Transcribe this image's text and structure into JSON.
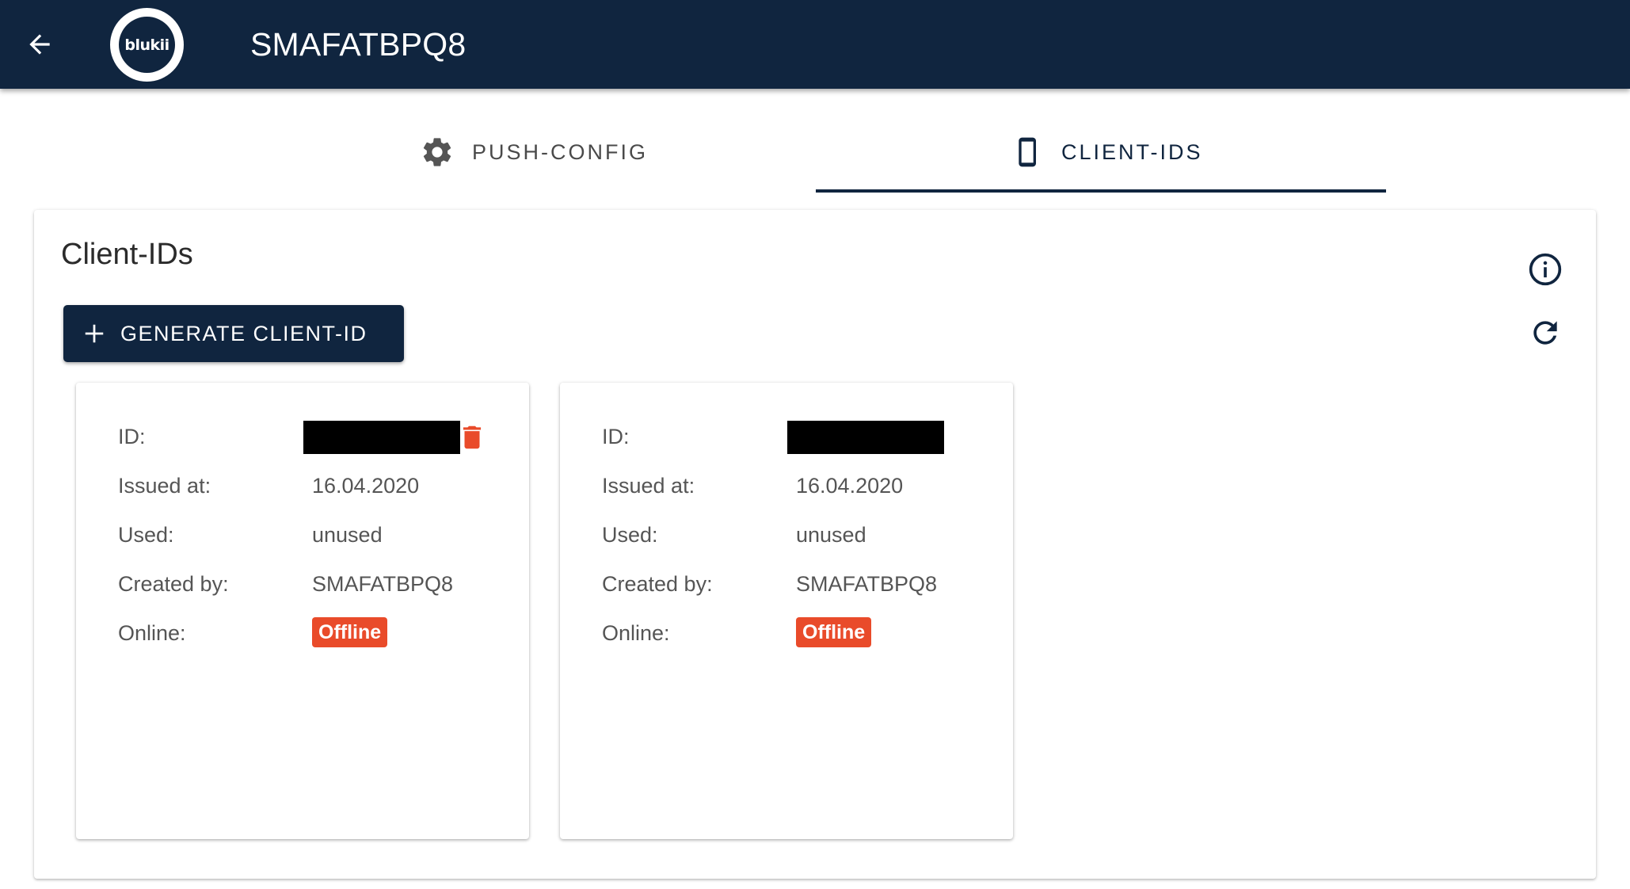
{
  "header": {
    "back_icon": "arrow-left-icon",
    "logo_text": "blukii",
    "title": "SMAFATBPQ8"
  },
  "tabs": [
    {
      "label": "PUSH-CONFIG",
      "icon": "gear-icon",
      "active": false
    },
    {
      "label": "CLIENT-IDS",
      "icon": "phone-icon",
      "active": true
    }
  ],
  "panel": {
    "title": "Client-IDs",
    "generate_button": {
      "icon": "plus-icon",
      "label": "GENERATE CLIENT-ID"
    },
    "info_icon": "info-icon",
    "refresh_icon": "refresh-icon"
  },
  "labels": {
    "id": "ID:",
    "issued_at": "Issued at:",
    "used": "Used:",
    "created_by": "Created by:",
    "online": "Online:"
  },
  "clients": [
    {
      "id_redacted": true,
      "issued_at": "16.04.2020",
      "used": "unused",
      "created_by": "SMAFATBPQ8",
      "online": "Offline",
      "show_delete": true
    },
    {
      "id_redacted": true,
      "issued_at": "16.04.2020",
      "used": "unused",
      "created_by": "SMAFATBPQ8",
      "online": "Offline",
      "show_delete": false
    }
  ],
  "colors": {
    "primary": "#10253f",
    "offline": "#e94b2a",
    "delete": "#e94b2a"
  }
}
